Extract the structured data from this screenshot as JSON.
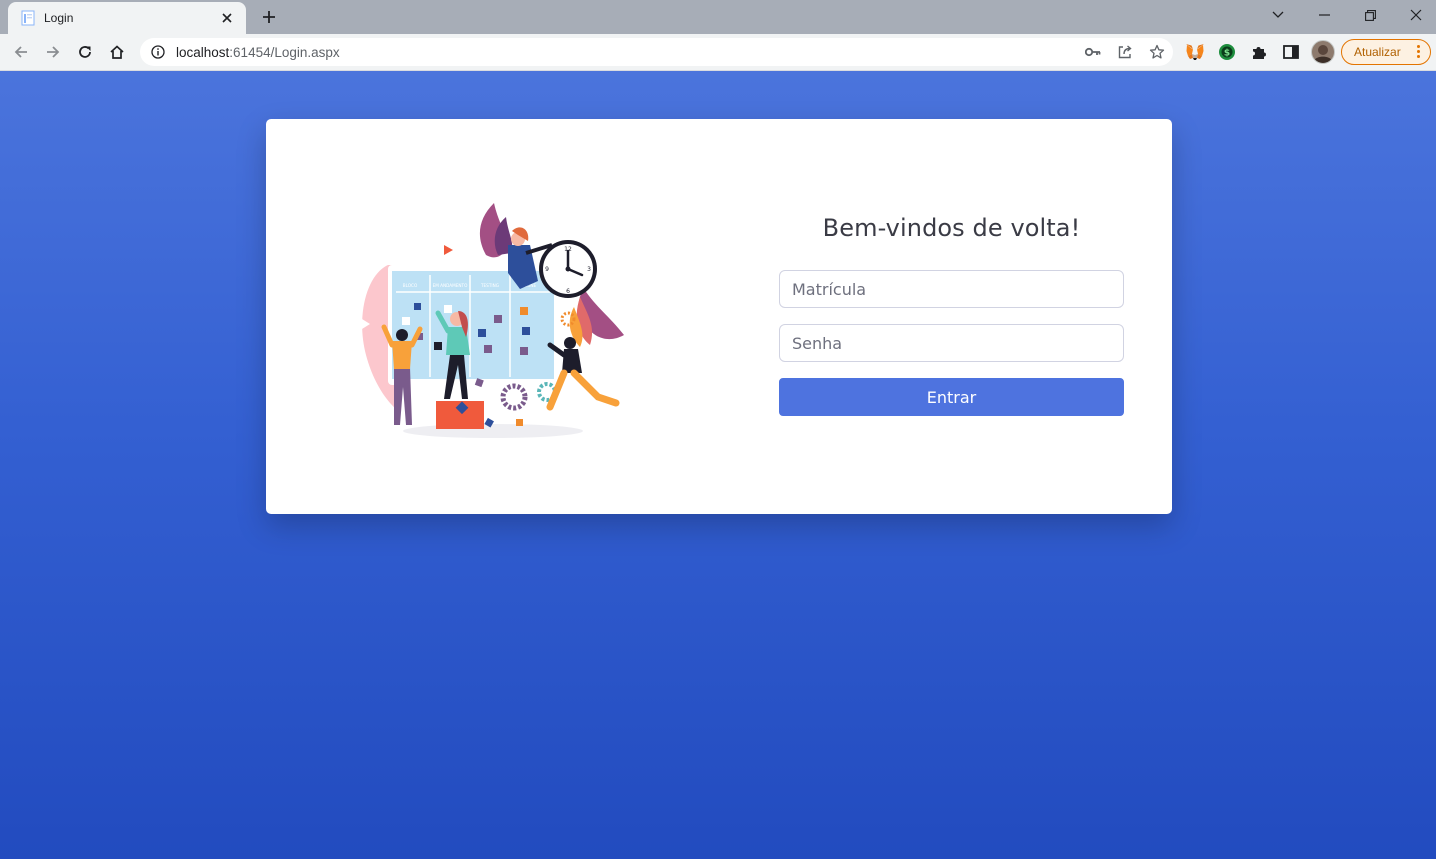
{
  "browser": {
    "tab_title": "Login",
    "url_host": "localhost",
    "url_rest": ":61454/Login.aspx",
    "update_label": "Atualizar",
    "accent": "#e37400"
  },
  "login": {
    "heading": "Bem-vindos de volta!",
    "username_placeholder": "Matrícula",
    "password_placeholder": "Senha",
    "submit_label": "Entrar",
    "button_color": "#4e73df"
  },
  "illustration": {
    "board_columns": [
      "BLOCO",
      "EM ANDAMENTO",
      "TESTING",
      "DONE"
    ]
  }
}
